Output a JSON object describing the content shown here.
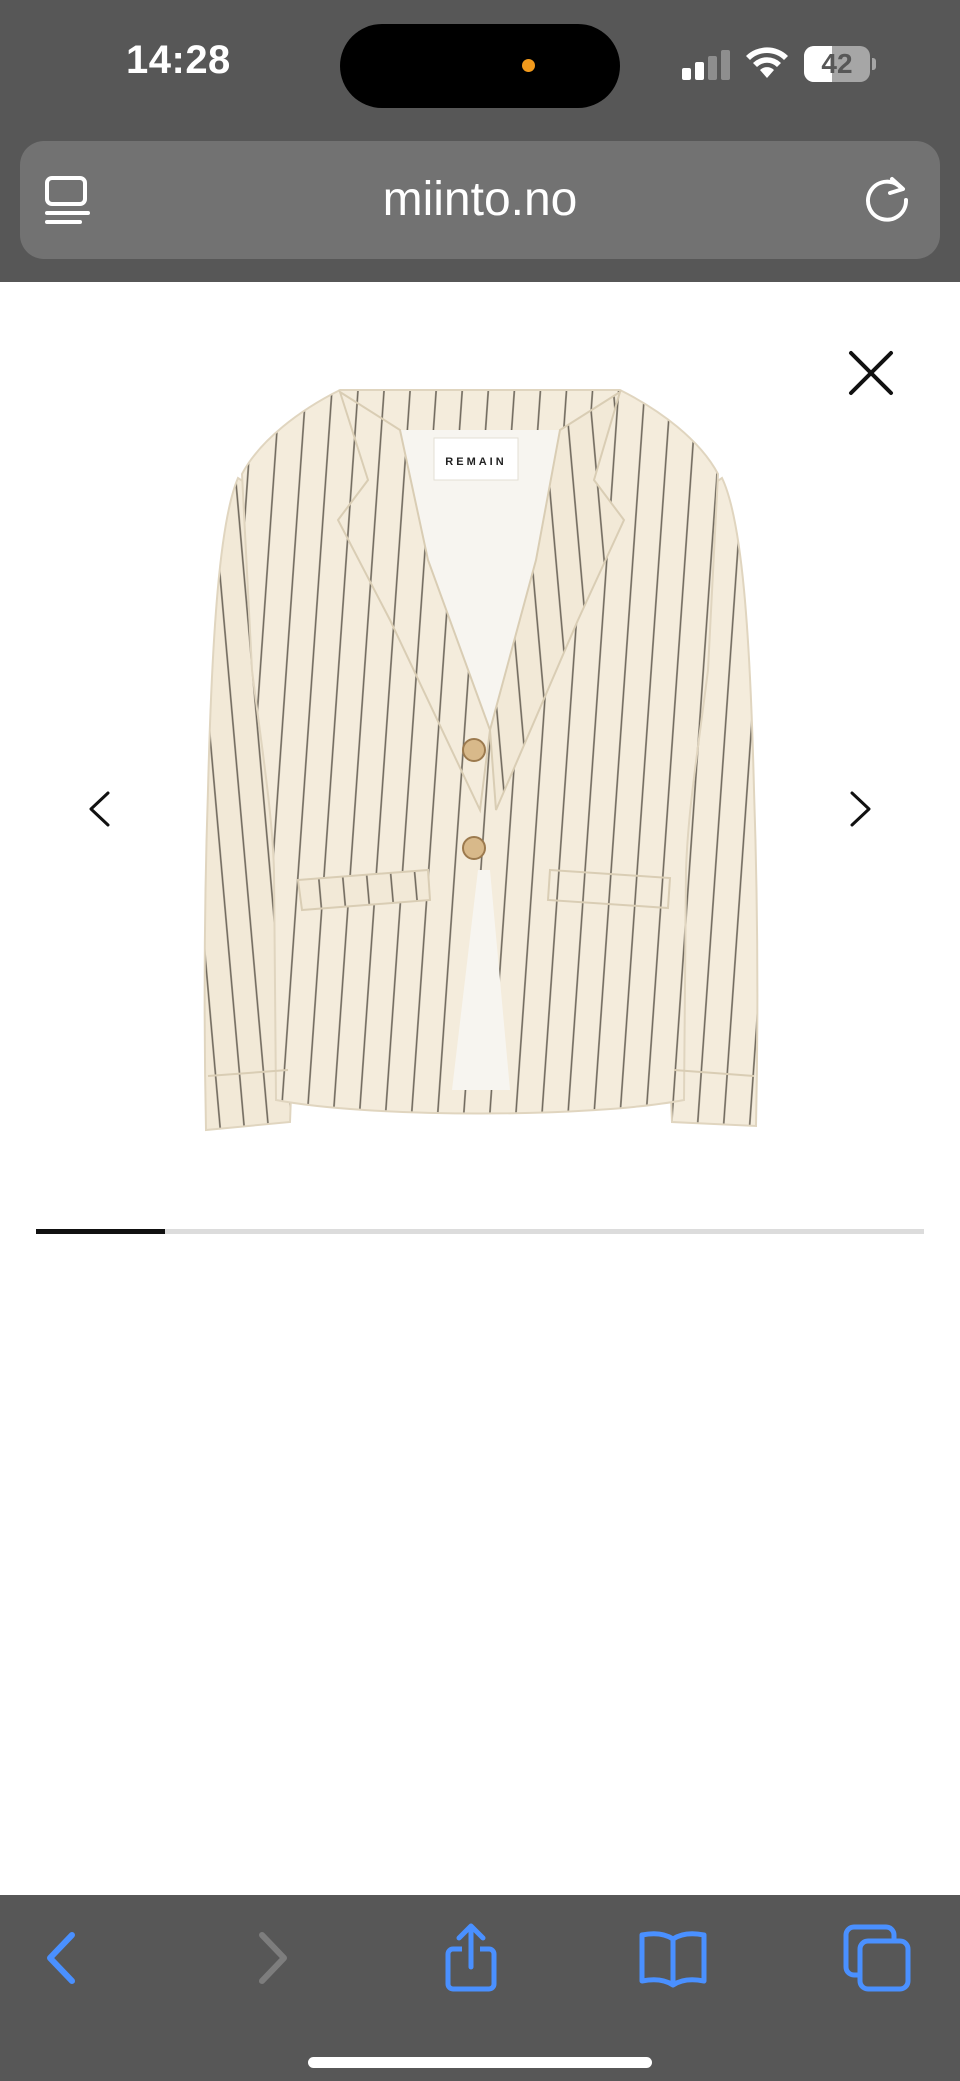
{
  "status_bar": {
    "time": "14:28",
    "battery_level": "42",
    "battery_fraction": 0.42,
    "privacy_dot_color": "#f29a1c"
  },
  "browser": {
    "url": "miinto.no",
    "reader_icon": "reader-mode-icon",
    "reload_icon": "reload-icon"
  },
  "gallery": {
    "close_icon": "close-icon",
    "prev_icon": "chevron-left-icon",
    "next_icon": "chevron-right-icon",
    "image_brand_label": "REMAIN",
    "image_description": "cream pinstripe blazer",
    "progress_fraction": 0.145
  },
  "toolbar": {
    "back_icon": "back-icon",
    "forward_icon": "forward-icon",
    "share_icon": "share-icon",
    "bookmarks_icon": "bookmarks-icon",
    "tabs_icon": "tabs-icon",
    "accent_color": "#4a90ff"
  },
  "colors": {
    "chrome_background": "#575757",
    "url_bar_background": "#727272",
    "page_background": "#ffffff"
  }
}
